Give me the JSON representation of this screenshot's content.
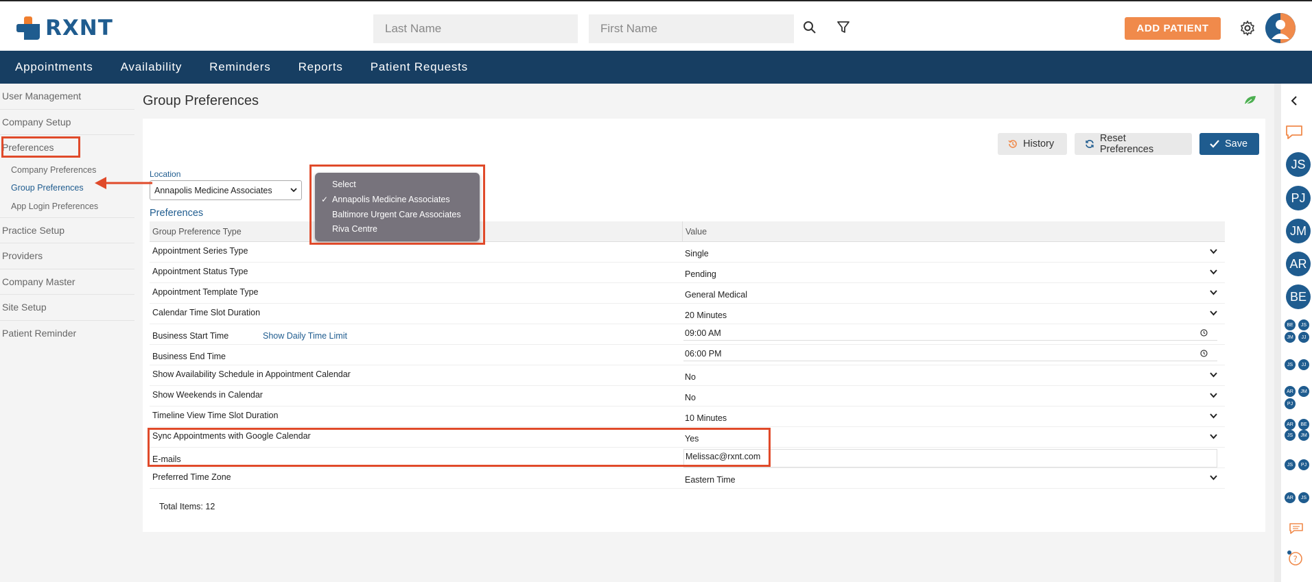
{
  "brand": {
    "name": "RXNT"
  },
  "search": {
    "last_name_placeholder": "Last Name",
    "first_name_placeholder": "First Name"
  },
  "header": {
    "add_patient_label": "ADD PATIENT"
  },
  "nav": {
    "items": [
      "Appointments",
      "Availability",
      "Reminders",
      "Reports",
      "Patient Requests"
    ]
  },
  "sidebar": {
    "items": [
      "User Management",
      "Company Setup",
      "Preferences",
      "Company Preferences",
      "Group Preferences",
      "App Login Preferences",
      "Practice Setup",
      "Providers",
      "Company Master",
      "Site Setup",
      "Patient Reminder"
    ]
  },
  "page": {
    "title": "Group Preferences"
  },
  "toolbar": {
    "history_label": "History",
    "reset_label": "Reset Preferences",
    "save_label": "Save"
  },
  "location": {
    "label": "Location",
    "selected": "Annapolis Medicine Associates",
    "options": [
      "Select",
      "Annapolis Medicine Associates",
      "Baltimore Urgent Care Associates",
      "Riva Centre"
    ]
  },
  "preferences": {
    "section_label": "Preferences",
    "columns": [
      "Group Preference Type",
      "Value"
    ],
    "rows": [
      {
        "type": "Appointment Series Type",
        "value": "Single"
      },
      {
        "type": "Appointment Status Type",
        "value": "Pending"
      },
      {
        "type": "Appointment Template Type",
        "value": "General Medical"
      },
      {
        "type": "Calendar Time Slot Duration",
        "value": "20 Minutes"
      },
      {
        "type": "Business Start Time",
        "value": "09:00  AM",
        "link": "Show Daily Time Limit"
      },
      {
        "type": "Business End Time",
        "value": "06:00  PM"
      },
      {
        "type": "Show Availability Schedule in Appointment Calendar",
        "value": "No"
      },
      {
        "type": "Show Weekends in Calendar",
        "value": "No"
      },
      {
        "type": "Timeline View Time Slot Duration",
        "value": "10 Minutes"
      },
      {
        "type": "Sync Appointments with Google Calendar",
        "value": "Yes"
      },
      {
        "type": "E-mails",
        "value": "Melissac@rxnt.com"
      },
      {
        "type": "Preferred Time Zone",
        "value": "Eastern Time"
      }
    ],
    "total_label": "Total Items: 12"
  },
  "rail": {
    "bubbles": [
      "JS",
      "PJ",
      "JM",
      "AR",
      "BE"
    ],
    "mini_groups": [
      [
        "BE",
        "JS",
        "JM",
        "JJ"
      ],
      [
        "JS",
        "JJ"
      ],
      [
        "AR",
        "JM",
        "PJ"
      ],
      [
        "AR",
        "BE",
        "JS",
        "JM"
      ],
      [
        "JS",
        "PJ"
      ],
      [
        "AR",
        "JS"
      ]
    ]
  },
  "colors": {
    "brand_blue": "#1f5c8f",
    "nav_bg": "#173e62",
    "accent_orange": "#f08a4b",
    "annotation_red": "#e04a2a"
  }
}
